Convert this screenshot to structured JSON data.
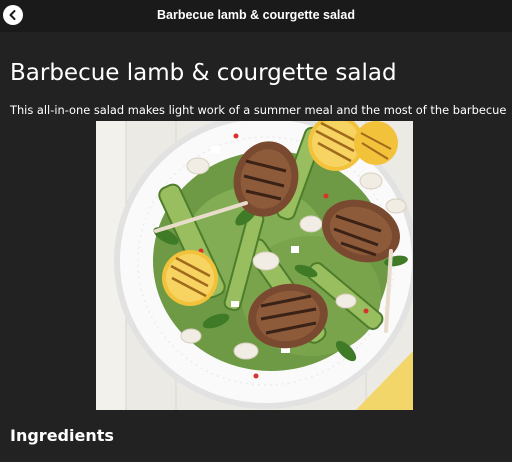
{
  "header": {
    "title": "Barbecue lamb & courgette salad",
    "back_icon": "chevron-left-icon"
  },
  "recipe": {
    "title": "Barbecue lamb & courgette salad",
    "description": "This all-in-one salad makes light work of a summer meal and the most of the barbecue",
    "ingredients_heading": "Ingredients"
  },
  "colors": {
    "background": "#222222",
    "topbar": "#1a1a1a",
    "text": "#ffffff"
  }
}
